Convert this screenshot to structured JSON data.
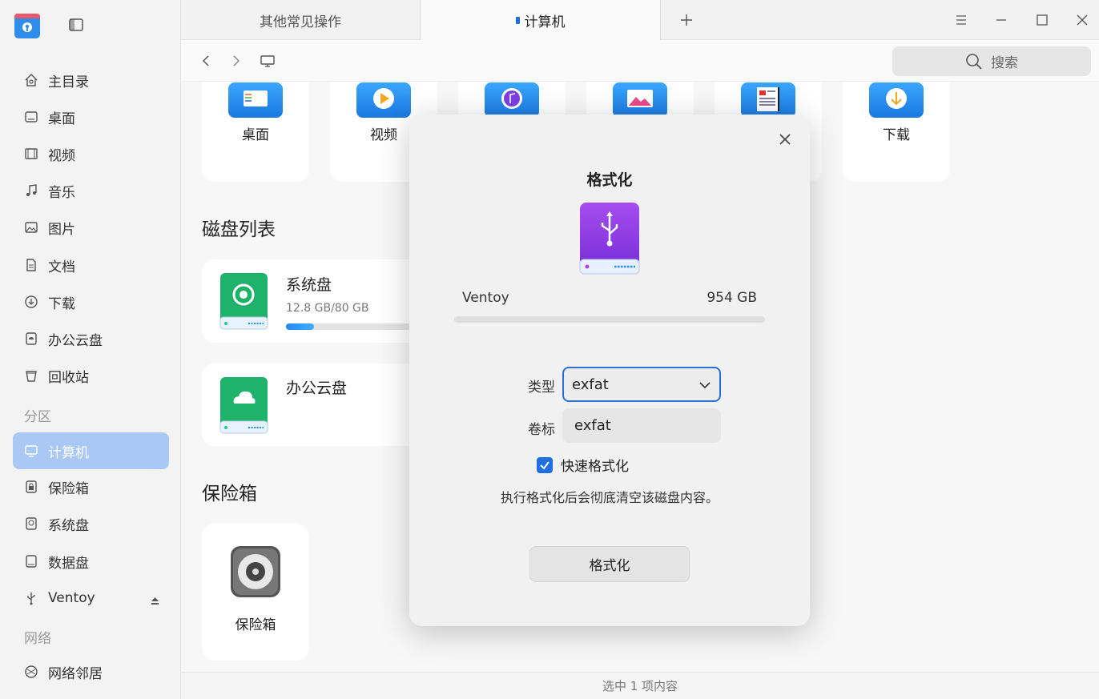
{
  "sidebar": {
    "items": [
      {
        "label": "主目录",
        "icon": "home-icon"
      },
      {
        "label": "桌面",
        "icon": "desktop-icon"
      },
      {
        "label": "视频",
        "icon": "video-icon"
      },
      {
        "label": "音乐",
        "icon": "music-icon"
      },
      {
        "label": "图片",
        "icon": "picture-icon"
      },
      {
        "label": "文档",
        "icon": "document-icon"
      },
      {
        "label": "下载",
        "icon": "download-icon"
      },
      {
        "label": "办公云盘",
        "icon": "cloud-disk-icon"
      },
      {
        "label": "回收站",
        "icon": "trash-icon"
      }
    ],
    "section_partition": "分区",
    "partition_items": [
      {
        "label": "计算机",
        "icon": "computer-icon",
        "active": true
      },
      {
        "label": "保险箱",
        "icon": "vault-icon"
      },
      {
        "label": "系统盘",
        "icon": "system-disk-icon"
      },
      {
        "label": "数据盘",
        "icon": "data-disk-icon"
      },
      {
        "label": "Ventoy",
        "icon": "usb-icon"
      }
    ],
    "section_network": "网络",
    "network_items": [
      {
        "label": "网络邻居",
        "icon": "network-icon"
      }
    ]
  },
  "tabs": [
    {
      "label": "其他常见操作"
    },
    {
      "label": "计算机",
      "active": true
    }
  ],
  "search": {
    "placeholder": "搜索"
  },
  "quick_access": [
    {
      "label": "桌面"
    },
    {
      "label": "视频"
    },
    {
      "label": "下载"
    }
  ],
  "disk_section": {
    "title": "磁盘列表",
    "disks": [
      {
        "name": "系统盘",
        "size": "12.8 GB/80 GB",
        "usage": 0.16
      },
      {
        "name": "办公云盘"
      }
    ]
  },
  "vault_section": {
    "title": "保险箱",
    "item_label": "保险箱"
  },
  "status": {
    "text": "选中 1 项内容"
  },
  "dialog": {
    "title": "格式化",
    "device_name": "Ventoy",
    "capacity": "954 GB",
    "type_label": "类型",
    "type_value": "exfat",
    "volume_label": "卷标",
    "volume_value": "exfat",
    "quick_format_label": "快速格式化",
    "quick_format_checked": true,
    "warning": "执行格式化后会彻底清空该磁盘内容。",
    "format_button": "格式化"
  },
  "colors": {
    "accent": "#1f6fe0",
    "sidebar_active": "#a9c8f3",
    "usb_purple": "#8b3fe0"
  }
}
